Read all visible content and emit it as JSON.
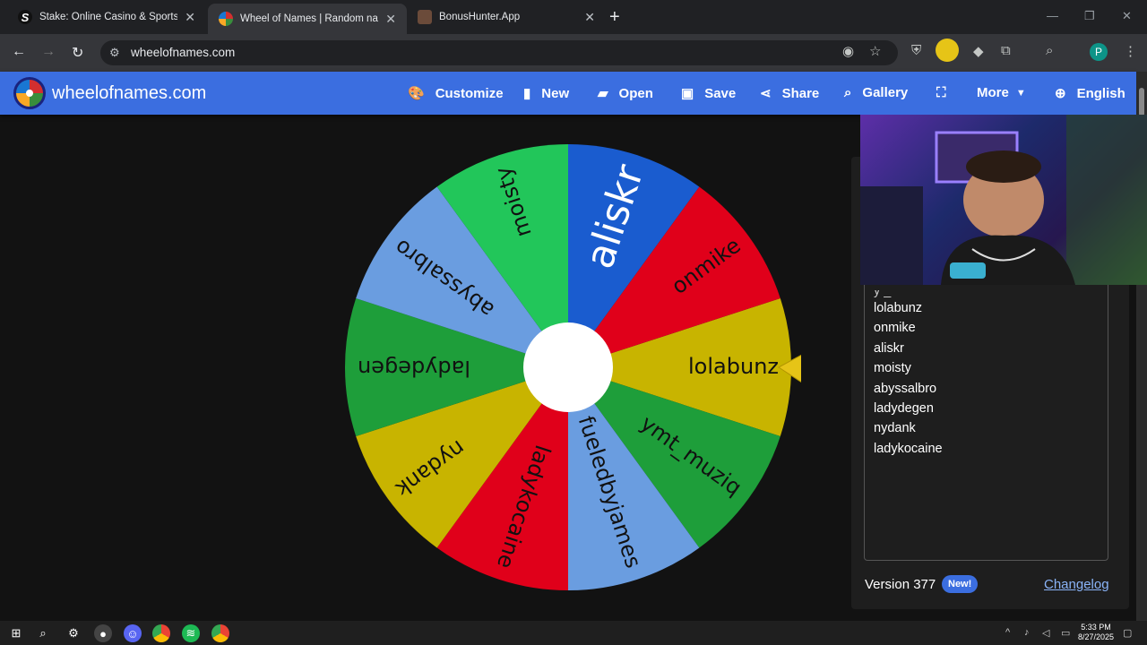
{
  "browser": {
    "tabs": [
      {
        "title": "Stake: Online Casino & Sports Betting",
        "favicon_color": "#111111",
        "favicon_text": "S"
      },
      {
        "title": "Wheel of Names | Random name picker",
        "favicon_color": "#3b6ee0",
        "favicon_text": ""
      },
      {
        "title": "BonusHunter.App",
        "favicon_color": "#6b4b3a",
        "favicon_text": ""
      }
    ],
    "url": "wheelofnames.com",
    "profile_initial": "P"
  },
  "app": {
    "brand": "wheelofnames.com",
    "menu": {
      "customize": "Customize",
      "new": "New",
      "open": "Open",
      "save": "Save",
      "share": "Share",
      "gallery": "Gallery",
      "more": "More",
      "language": "English"
    }
  },
  "wheel": {
    "segments": [
      {
        "label": "lolabunz",
        "color": "#c8b400"
      },
      {
        "label": "ymt_muziq",
        "color": "#1e9e3a"
      },
      {
        "label": "fueledbyjames",
        "color": "#6a9de0"
      },
      {
        "label": "ladykocaine",
        "color": "#e0001a"
      },
      {
        "label": "nydank",
        "color": "#c8b400"
      },
      {
        "label": "ladydegen",
        "color": "#1e9e3a"
      },
      {
        "label": "abyssalbro",
        "color": "#6a9de0"
      },
      {
        "label": "moisty",
        "color": "#22c65a"
      },
      {
        "label": "aliskr",
        "color": "#1a5ccf"
      },
      {
        "label": "onmike",
        "color": "#e0001a"
      }
    ],
    "pointer_color": "#e6c417"
  },
  "entries": {
    "partial_top": "y _",
    "items": [
      "lolabunz",
      "onmike",
      "aliskr",
      "moisty",
      "abyssalbro",
      "ladydegen",
      "nydank",
      "ladykocaine"
    ]
  },
  "footer": {
    "version": "Version 377",
    "badge": "New!",
    "changelog": "Changelog"
  },
  "taskbar": {
    "time": "5:33 PM",
    "date": "8/27/2025"
  }
}
